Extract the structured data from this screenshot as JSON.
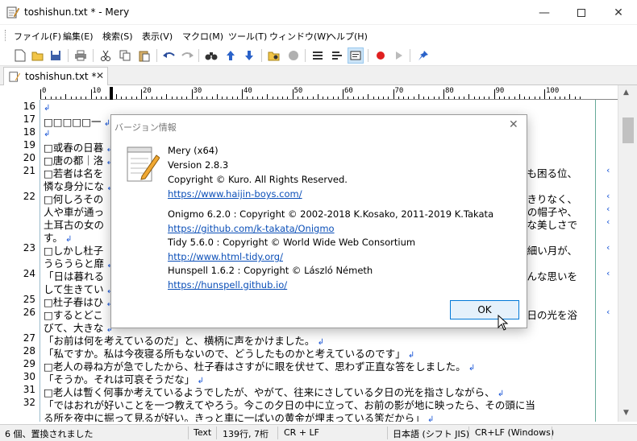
{
  "window": {
    "title": "toshishun.txt * - Mery",
    "icon": "notepad-pencil-icon"
  },
  "menu": [
    "ファイル(F)",
    "編集(E)",
    "検索(S)",
    "表示(V)",
    "マクロ(M)",
    "ツール(T)",
    "ウィンドウ(W)",
    "ヘルプ(H)"
  ],
  "tab": {
    "label": "toshishun.txt *"
  },
  "ruler": {
    "labels": [
      "0",
      "10",
      "20",
      "30",
      "40",
      "50",
      "60",
      "70",
      "80",
      "90",
      "100"
    ]
  },
  "lines": [
    {
      "n": "16",
      "text": ""
    },
    {
      "n": "17",
      "text": "□□□□□一"
    },
    {
      "n": "18",
      "text": ""
    },
    {
      "n": "19",
      "text": "□或春の日暮"
    },
    {
      "n": "20",
      "text": "□唐の都｜洛"
    },
    {
      "n": "21",
      "text": "□若者は名を",
      "right": "にも困る位、"
    },
    {
      "n": "",
      "text": "憐な身分にな"
    },
    {
      "n": "22",
      "text": "□何しろその",
      "right": "しっきりなく、"
    },
    {
      "n": "",
      "text": "人や車が通っ",
      "right": "紗の帽子や、"
    },
    {
      "n": "",
      "text": "土耳古の女の",
      "right": "うな美しさで"
    },
    {
      "n": "",
      "text": "す。"
    },
    {
      "n": "23",
      "text": "□しかし杜子",
      "right": "もう細い月が、"
    },
    {
      "n": "",
      "text": "うらうらと靡"
    },
    {
      "n": "24",
      "text": "「日は暮れる",
      "right": "こんな思いを"
    },
    {
      "n": "",
      "text": "して生きてい"
    },
    {
      "n": "25",
      "text": "□杜子春はひ"
    },
    {
      "n": "26",
      "text": "□するとどこ",
      "right": "夕日の光を浴"
    },
    {
      "n": "",
      "text": "びて、大きな"
    },
    {
      "n": "27",
      "text": "「お前は何を考えているのだ」と、横柄に声をかけました。"
    },
    {
      "n": "28",
      "text": "「私ですか。私は今夜寝る所もないので、どうしたものかと考えているのです」"
    },
    {
      "n": "29",
      "text": "□老人の尋ね方が急でしたから、杜子春はさすがに眼を伏せて、思わず正直な答をしました。"
    },
    {
      "n": "30",
      "text": "「そうか。それは可哀そうだな」"
    },
    {
      "n": "31",
      "text": "□老人は暫く何事か考えているようでしたが、やがて、往来にさしている夕日の光を指さしながら、"
    },
    {
      "n": "32",
      "text": "「ではおれが好いことを一つ教えてやろう。今この夕日の中に立って、お前の影が地に映ったら、その頭に当"
    },
    {
      "n": "",
      "text": "る所を夜中に掘って見るが好い。きっと車に一ぱいの黄金が埋まっている筈だから」"
    }
  ],
  "status": {
    "message": "6 個、置換されました",
    "mode": "Text",
    "position": "139行, 7桁",
    "eol": "CR + LF",
    "encoding": "日本語 (シフト JIS)",
    "eol_format": "CR+LF (Windows)"
  },
  "dialog": {
    "title": "バージョン情報",
    "app": "Mery (x64)",
    "version": "Version 2.8.3",
    "copyright": "Copyright © Kuro. All Rights Reserved.",
    "link1": "https://www.haijin-boys.com/",
    "onigmo": "Onigmo 6.2.0 : Copyright © 2002-2018 K.Kosako, 2011-2019 K.Takata",
    "link2": "https://github.com/k-takata/Onigmo",
    "tidy": "Tidy 5.6.0 : Copyright © World Wide Web Consortium",
    "link3": "http://www.html-tidy.org/",
    "hunspell": "Hunspell 1.6.2 : Copyright © László Németh",
    "link4": "https://hunspell.github.io/",
    "ok": "OK"
  },
  "colors": {
    "accent": "#0078d7",
    "marks": "#1a56d6"
  }
}
